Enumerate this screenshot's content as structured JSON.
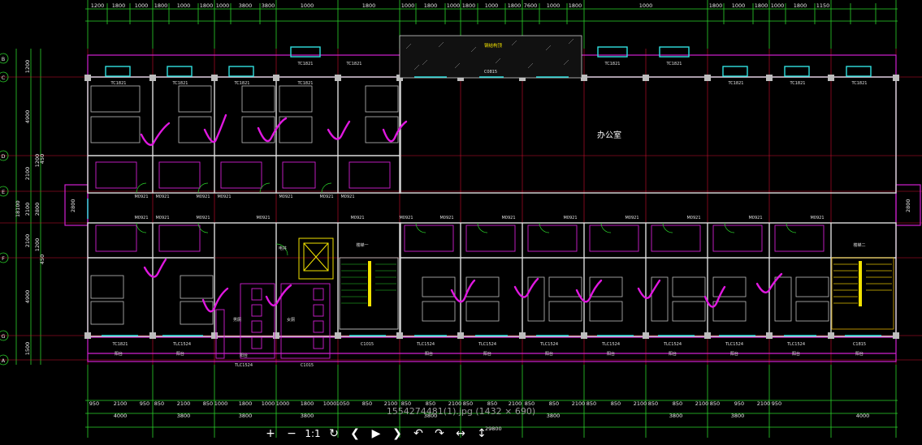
{
  "viewer": {
    "caption": "1554274481(1).jpg (1432 × 690)",
    "toolbar": {
      "zoom_in": "+",
      "zoom_out": "−",
      "actual_size": "1:1",
      "reset": "↻",
      "prev": "❮",
      "play": "▶",
      "next": "❯",
      "rotate_left": "↶",
      "rotate_right": "↷",
      "flip_horizontal": "↔",
      "flip_vertical": "↕"
    }
  },
  "drawing": {
    "office_label": "办公室",
    "roof_label": "钢结构顶",
    "top_dims": [
      "1200",
      "1800",
      "1000",
      "1800",
      "1000",
      "1800",
      "1000",
      "3800",
      "3800",
      "1000",
      "1800",
      "1000",
      "1800",
      "1000",
      "1800",
      "1000",
      "1800",
      "7600",
      "1000",
      "1800",
      "1000",
      "1800",
      "1000",
      "1800",
      "1000",
      "1800",
      "1150"
    ],
    "bottom_dims_1": [
      "950",
      "2100",
      "950",
      "850",
      "2100",
      "850",
      "1000",
      "1800",
      "1000",
      "1000",
      "1800",
      "1000",
      "1050",
      "850",
      "2100",
      "850",
      "850",
      "2100",
      "850",
      "850",
      "2100",
      "850",
      "850",
      "2100",
      "850",
      "850",
      "2100",
      "850",
      "850",
      "2100",
      "850",
      "950",
      "2100",
      "950"
    ],
    "bottom_dims_2": [
      "4000",
      "3800",
      "3800",
      "3800",
      "3800",
      "3800",
      "3800",
      "3800",
      "4000"
    ],
    "bottom_total": "29800",
    "left_dims": [
      "1200",
      "4900",
      "2100",
      "1200",
      "450",
      "2100",
      "2800",
      "2100",
      "1200",
      "450",
      "4900",
      "1500"
    ],
    "left_total": "18100",
    "grid_labels": [
      "B",
      "C",
      "D",
      "E",
      "F",
      "G",
      "A"
    ],
    "window_labels": [
      "TC1821",
      "TC1821",
      "TC1821",
      "TC1821",
      "TC1821",
      "TC1821",
      "C0815",
      "TC1821",
      "TC1821",
      "TC1821",
      "TC1821",
      "TC1821",
      "TC1821",
      "TLC1524",
      "TLC1524",
      "TLC1524",
      "TLC1524",
      "TLC1524",
      "TLC1524",
      "TLC1524",
      "TLC1524",
      "TLC1524",
      "C1015",
      "C1015",
      "C1815"
    ],
    "door_labels": [
      "M0921",
      "M0921",
      "M0921",
      "M0921",
      "M0921",
      "M0921",
      "M0921",
      "M0921",
      "M0921",
      "M0921",
      "M0921",
      "M0921",
      "M0921",
      "M0921",
      "M0921",
      "M0921",
      "M0921",
      "M0921",
      "M0921",
      "M0921"
    ],
    "room_labels": [
      "男厕",
      "女厕",
      "阳台",
      "阳台",
      "阳台",
      "阳台",
      "阳台",
      "阳台",
      "阳台",
      "阳台",
      "阳台",
      "阳台",
      "阳台",
      "楼梯一",
      "楼梯二",
      "电井"
    ],
    "side_dims": [
      "2800",
      "2800"
    ]
  }
}
